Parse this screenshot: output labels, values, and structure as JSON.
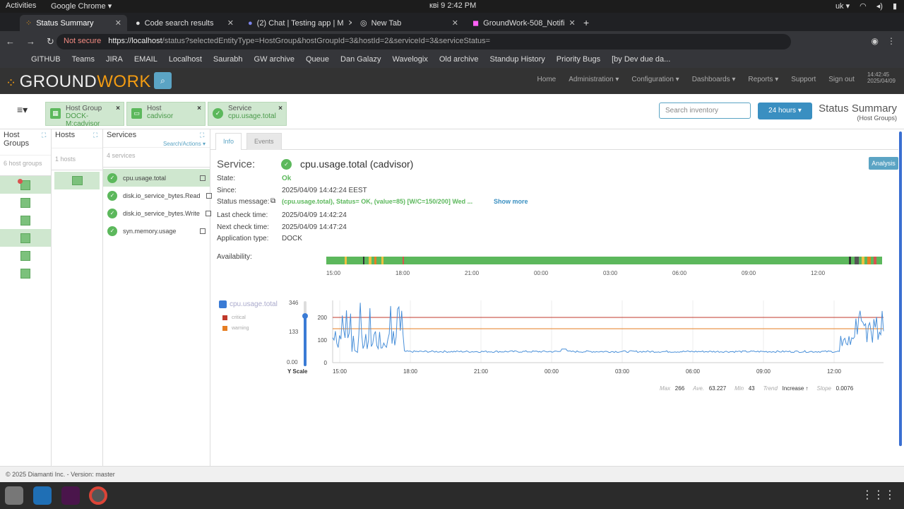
{
  "os": {
    "activities": "Activities",
    "app": "Google Chrome ▾",
    "clock": "квi 9  2:42 PM",
    "lang": "uk ▾"
  },
  "browser": {
    "tabs": [
      {
        "label": "Status Summary",
        "active": true
      },
      {
        "label": "Code search results"
      },
      {
        "label": "(2) Chat | Testing app | M"
      },
      {
        "label": "New Tab"
      },
      {
        "label": "GroundWork-508_Notifi"
      }
    ],
    "not_secure": "Not secure",
    "url_host": "https://localhost",
    "url_rest": "/status?selectedEntityType=HostGroup&hostGroupId=3&hostId=2&serviceId=3&serviceStatus=",
    "bookmarks": [
      "GITHUB",
      "Teams",
      "JIRA",
      "EMAIL",
      "Localhost",
      "Saurabh",
      "GW archive",
      "Queue",
      "Dan Galazy",
      "Wavelogix",
      "Old archive",
      "Standup History",
      "Priority Bugs",
      "[by Dev due da..."
    ]
  },
  "header": {
    "logo_a": "GROUND",
    "logo_b": "WORK",
    "menu": [
      "Home",
      "Administration ▾",
      "Configuration ▾",
      "Dashboards ▾",
      "Reports ▾",
      "Support",
      "Sign out"
    ],
    "time": "14:42:45",
    "date": "2025/04/09"
  },
  "crumbs": [
    {
      "k": "Host Group",
      "v": "DOCK-M:cadvisor"
    },
    {
      "k": "Host",
      "v": "cadvisor"
    },
    {
      "k": "Service",
      "v": "cpu.usage.total"
    }
  ],
  "search_placeholder": "Search inventory",
  "range": "24 hours ▾",
  "page_title": "Status Summary",
  "page_subtitle": "(Host Groups)",
  "columns": {
    "hostgroups": {
      "title": "Host Groups",
      "count": "6 host groups"
    },
    "hosts": {
      "title": "Hosts",
      "count": "1 hosts"
    },
    "services": {
      "title": "Services",
      "count": "4 services",
      "actions": "Search/Actions ▾",
      "items": [
        "cpu.usage.total",
        "disk.io_service_bytes.Read",
        "disk.io_service_bytes.Write",
        "syn.memory.usage"
      ]
    }
  },
  "info": {
    "tabs": [
      "Info",
      "Events"
    ],
    "service_label": "Service:",
    "service_name": "cpu.usage.total  (cadvisor)",
    "analysis": "Analysis",
    "rows": [
      {
        "k": "State:",
        "v": "Ok"
      },
      {
        "k": "Since:",
        "v": "2025/04/09 14:42:24 EEST"
      },
      {
        "k": "Status message:",
        "v": "(cpu.usage.total), Status= OK, (value=85) [W/C=150/200] Wed ..."
      },
      {
        "k": "Last check time:",
        "v": "2025/04/09 14:42:24"
      },
      {
        "k": "Next check time:",
        "v": "2025/04/09 14:47:24"
      },
      {
        "k": "Application type:",
        "v": "DOCK"
      }
    ],
    "show_more": "Show more",
    "availability": "Availability:",
    "time_ticks": [
      "15:00",
      "18:00",
      "21:00",
      "00:00",
      "03:00",
      "06:00",
      "09:00",
      "12:00"
    ]
  },
  "chart_data": {
    "type": "line",
    "series": [
      {
        "name": "cpu.usage.total",
        "color": "#4a90d9"
      }
    ],
    "thresholds": [
      {
        "name": "critical",
        "value": 200,
        "color": "#c0392b"
      },
      {
        "name": "warning",
        "value": 150,
        "color": "#e67e22"
      }
    ],
    "yticks": [
      0,
      100,
      200
    ],
    "ylim": [
      0,
      275
    ],
    "yscale_labels": [
      "346",
      "133",
      "0.00"
    ],
    "yscale_title": "Y Scale",
    "xticks": [
      "15:00",
      "18:00",
      "21:00",
      "00:00",
      "03:00",
      "06:00",
      "09:00",
      "12:00"
    ],
    "stats": [
      {
        "k": "Max",
        "v": "266"
      },
      {
        "k": "Ave.",
        "v": "63.227"
      },
      {
        "k": "Min",
        "v": "43"
      },
      {
        "k": "Trend",
        "v": "Increase ↑"
      },
      {
        "k": "Slope",
        "v": "0.0076"
      }
    ]
  },
  "footer": "© 2025 Diamanti Inc. - Version: master"
}
